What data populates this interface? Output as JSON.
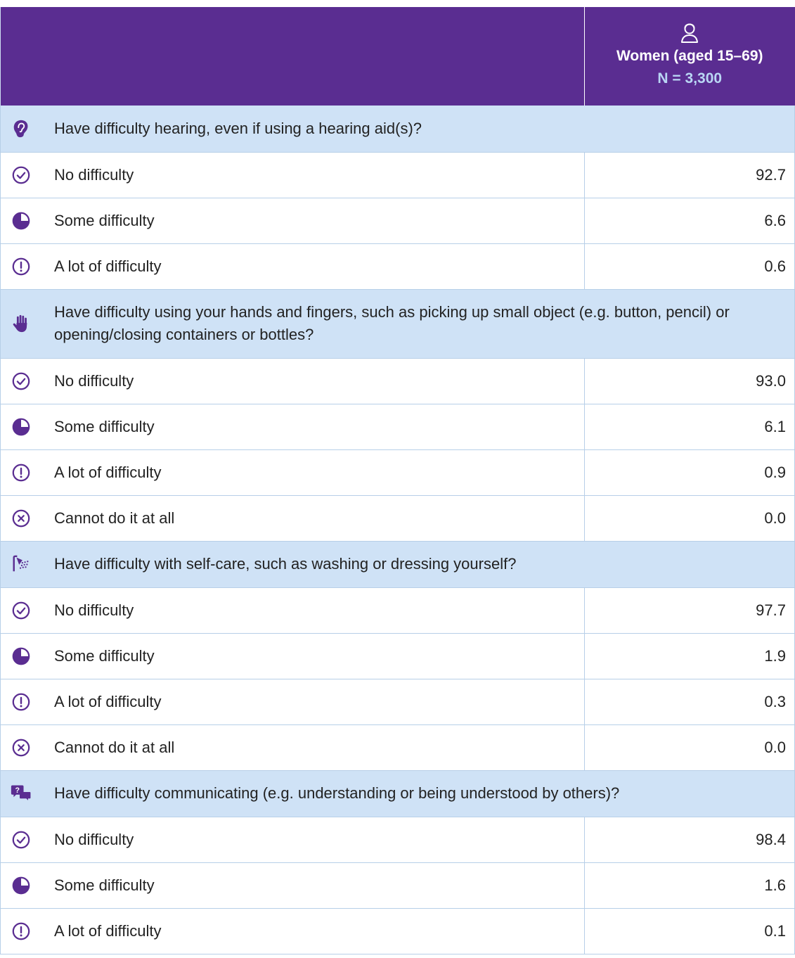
{
  "header": {
    "column_title": "Women (aged 15–69)",
    "n_label": "N = 3,300",
    "icon": "woman-icon"
  },
  "colors": {
    "header_bg": "#5a2d91",
    "question_bg": "#cfe2f6",
    "accent": "#5a2d91",
    "n_label": "#b9d6f4"
  },
  "sections": [
    {
      "icon": "ear-icon",
      "question": "Have difficulty hearing, even if using a hearing aid(s)?",
      "rows": [
        {
          "icon": "check-circle-icon",
          "label": "No difficulty",
          "value": "92.7"
        },
        {
          "icon": "half-circle-icon",
          "label": "Some difficulty",
          "value": "6.6"
        },
        {
          "icon": "exclamation-circle-icon",
          "label": "A lot of difficulty",
          "value": "0.6"
        }
      ]
    },
    {
      "icon": "hand-icon",
      "question": "Have difficulty using your hands and fingers, such as picking up small object (e.g. button, pencil) or opening/closing containers or bottles?",
      "rows": [
        {
          "icon": "check-circle-icon",
          "label": "No difficulty",
          "value": "93.0"
        },
        {
          "icon": "half-circle-icon",
          "label": "Some difficulty",
          "value": "6.1"
        },
        {
          "icon": "exclamation-circle-icon",
          "label": "A lot of difficulty",
          "value": "0.9"
        },
        {
          "icon": "x-circle-icon",
          "label": "Cannot do it at all",
          "value": "0.0"
        }
      ]
    },
    {
      "icon": "shower-icon",
      "question": "Have difficulty with self-care, such as washing or dressing yourself?",
      "rows": [
        {
          "icon": "check-circle-icon",
          "label": "No difficulty",
          "value": "97.7"
        },
        {
          "icon": "half-circle-icon",
          "label": "Some difficulty",
          "value": "1.9"
        },
        {
          "icon": "exclamation-circle-icon",
          "label": "A lot of difficulty",
          "value": "0.3"
        },
        {
          "icon": "x-circle-icon",
          "label": "Cannot do it at all",
          "value": "0.0"
        }
      ]
    },
    {
      "icon": "speech-bubbles-icon",
      "question": "Have difficulty communicating (e.g. understanding or being understood by others)?",
      "rows": [
        {
          "icon": "check-circle-icon",
          "label": "No difficulty",
          "value": "98.4"
        },
        {
          "icon": "half-circle-icon",
          "label": "Some difficulty",
          "value": "1.6"
        },
        {
          "icon": "exclamation-circle-icon",
          "label": "A lot of difficulty",
          "value": "0.1"
        }
      ]
    }
  ]
}
